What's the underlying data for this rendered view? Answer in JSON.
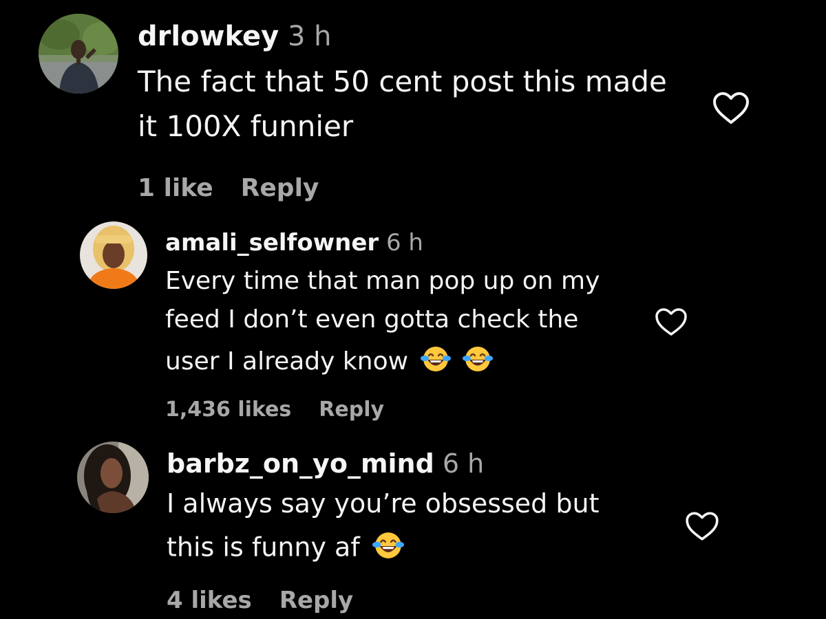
{
  "comments": [
    {
      "username": "drlowkey",
      "time": "3 h",
      "lines": [
        "The fact that 50 cent post this made",
        "it 100X funnier"
      ],
      "likes": "1 like",
      "reply": "Reply",
      "avatar_icon": "avatar-photo-man",
      "like_icon": "heart-outline-icon"
    },
    {
      "username": "amali_selfowner",
      "time": "6 h",
      "lines": [
        "Every time that man pop up on my",
        "feed I don’t even gotta check the",
        "user I already know"
      ],
      "emojis": [
        "face-with-tears-of-joy",
        "face-with-tears-of-joy"
      ],
      "likes": "1,436 likes",
      "reply": "Reply",
      "avatar_icon": "avatar-photo-woman-blonde",
      "like_icon": "heart-outline-icon"
    },
    {
      "username": "barbz_on_yo_mind",
      "time": "6 h",
      "lines": [
        "I always say you’re obsessed but",
        "this is funny af"
      ],
      "emojis": [
        "face-with-tears-of-joy"
      ],
      "likes": "4 likes",
      "reply": "Reply",
      "avatar_icon": "avatar-photo-woman-dark-hair",
      "like_icon": "heart-outline-icon"
    }
  ],
  "colors": {
    "background": "#000000",
    "text_primary": "#f5f5f5",
    "text_secondary": "#a8a8a8"
  }
}
